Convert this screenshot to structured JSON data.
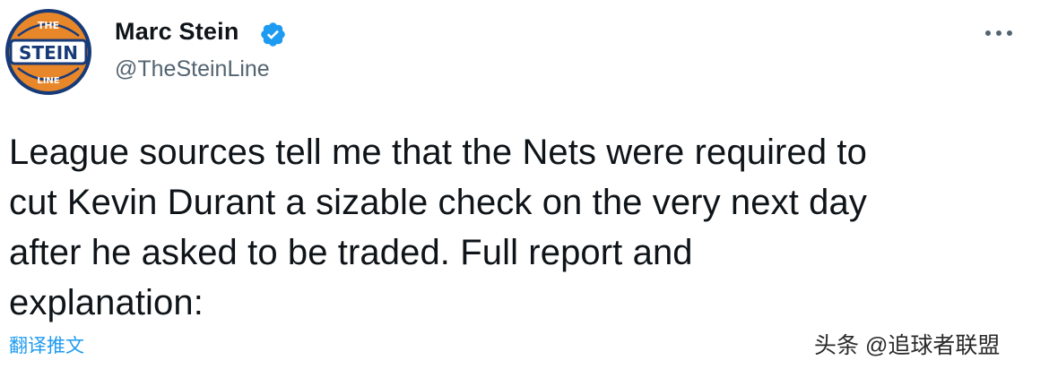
{
  "account": {
    "display_name": "Marc Stein",
    "handle": "@TheSteinLine",
    "avatar_text_top": "THE",
    "avatar_text_main": "STEIN",
    "avatar_text_bottom": "LINE"
  },
  "tweet": {
    "lines": [
      "League sources tell me that the Nets were required to",
      "cut Kevin Durant a sizable check on the very next day",
      "after he asked to be traded. Full report and",
      "explanation:"
    ],
    "translate_label": "翻译推文"
  },
  "watermark": {
    "text": "头条 @追球者联盟"
  },
  "icons": {
    "verified": "verified-badge-icon",
    "more": "more-horizontal-icon"
  },
  "colors": {
    "verified_blue": "#1d9bf0",
    "avatar_orange": "#e8872a",
    "avatar_navy": "#173a78",
    "link_blue": "#1d9bf0",
    "secondary_text": "#536471"
  }
}
